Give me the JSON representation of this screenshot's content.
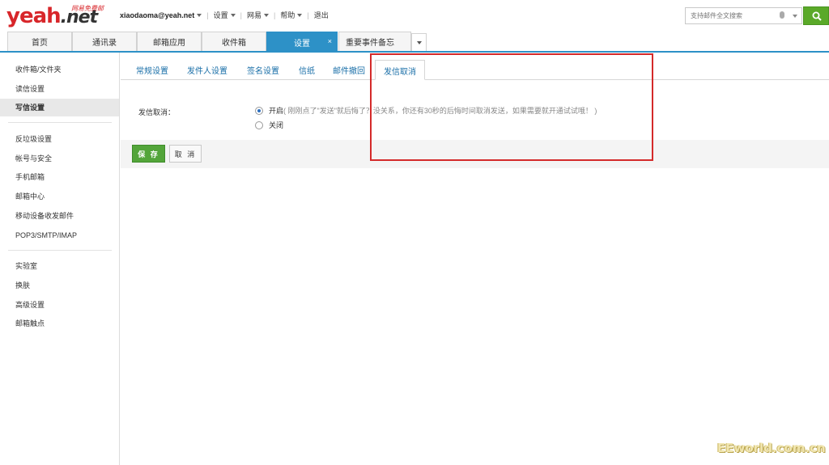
{
  "header": {
    "logo_text": "yeah",
    "logo_suffix": ".net",
    "logo_tagline": "网易免费邮",
    "user_email": "xiaodaoma@yeah.net",
    "nav": [
      "设置",
      "网易",
      "帮助"
    ],
    "logout_label": "退出",
    "search_placeholder": "支持邮件全文搜索"
  },
  "tabs": {
    "items": [
      "首页",
      "通讯录",
      "邮箱应用",
      "收件箱",
      "设置",
      "重要事件备忘"
    ],
    "active": "设置",
    "close_glyph": "×"
  },
  "sidebar": {
    "group1": [
      "收件箱/文件夹",
      "读信设置",
      "写信设置"
    ],
    "group2": [
      "反垃圾设置",
      "帐号与安全",
      "手机邮箱",
      "邮箱中心",
      "移动设备收发邮件",
      "POP3/SMTP/IMAP"
    ],
    "group3": [
      "实验室",
      "换肤",
      "高级设置",
      "邮箱触点"
    ],
    "active": "写信设置"
  },
  "settings": {
    "subtabs": [
      "常规设置",
      "发件人设置",
      "签名设置",
      "信纸",
      "邮件撤回",
      "发信取消"
    ],
    "active_subtab": "发信取消",
    "field_label": "发信取消：",
    "option_on": "开启",
    "option_on_hint": "( 刚刚点了\"发送\"就后悔了？没关系，你还有30秒的后悔时间取消发送，如果需要就开通试试哦！ )",
    "option_off": "关闭",
    "selected": "开启",
    "save_label": "保 存",
    "cancel_label": "取 消"
  },
  "watermark": "EEworld.com.cn",
  "colors": {
    "accent_blue": "#2d91c7",
    "save_green": "#53a53a",
    "highlight_red": "#d42a2a",
    "brand_red": "#d8262a"
  }
}
